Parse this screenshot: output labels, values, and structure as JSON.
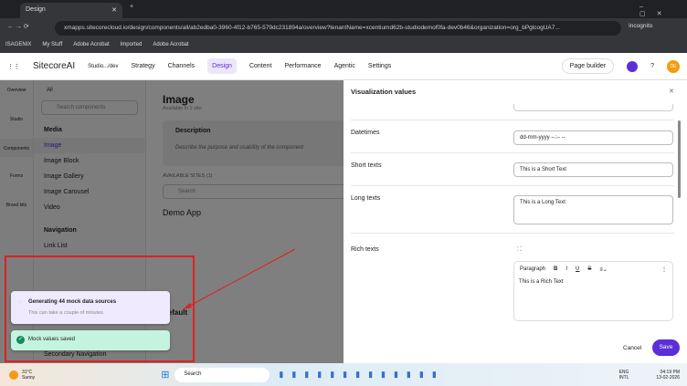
{
  "browser": {
    "tab_title": "Design",
    "url": "xmapps.sitecorecloud.io/design/components/all/ab2edba0-3960-4f12-b765-579dc231894a/overview?tenantName=xcentiumd62b-studiodemof0fa-dev0b46&organization=org_bPglcogUA7...",
    "incognito": "Incognito",
    "bookmarks": [
      "ISAGENIX",
      "My Stuff",
      "Adobe Acrobat",
      "Imported",
      "Adobe Acrobat"
    ]
  },
  "header": {
    "logo": "SitecoreAI",
    "site": "Studio.../dev",
    "nav": [
      "Strategy",
      "Channels",
      "Design",
      "Content",
      "Performance",
      "Agentic",
      "Settings"
    ],
    "page_builder": "Page builder",
    "avatar": "DE"
  },
  "rail": [
    "Overview",
    "Studio",
    "Components",
    "Forms",
    "Brand kits"
  ],
  "list": {
    "filter": "All",
    "search_placeholder": "Search components",
    "media_title": "Media",
    "media_items": [
      "Image",
      "Image Block",
      "Image Gallery",
      "Image Carousel",
      "Video"
    ],
    "nav_title": "Navigation",
    "nav_items": [
      "Link List",
      "Secondary Navigation"
    ]
  },
  "main": {
    "title": "Image",
    "subtitle": "Available in 1 site",
    "desc_title": "Description",
    "desc_text": "Describe the purpose and usability of the component",
    "sites_label": "AVAILABLE SITES (1)",
    "search_placeholder": "Search",
    "site_name": "Demo App",
    "variant": "Default"
  },
  "panel": {
    "title": "Visualization values",
    "fields": [
      {
        "label": "Datetimes",
        "value": "dd-mm-yyyy --:-- --"
      },
      {
        "label": "Short texts",
        "value": "This is a Short Text"
      },
      {
        "label": "Long texts",
        "value": "This is a Long Text"
      },
      {
        "label": "Rich texts",
        "value": "This is a Rich Text"
      }
    ],
    "paragraph": "Paragraph",
    "cancel": "Cancel",
    "save": "Save"
  },
  "toasts": {
    "gen_title": "Generating 44 mock data sources",
    "gen_sub": "This can take a couple of minutes.",
    "saved": "Mock values saved"
  },
  "taskbar": {
    "temp": "31°C",
    "weather": "Sunny",
    "search": "Search",
    "lang1": "ENG",
    "lang2": "INTL",
    "time": "04:19 PM",
    "date": "13-02-2026"
  },
  "colors": {
    "accent": "#5b2fd6",
    "annotation": "#e02020"
  }
}
